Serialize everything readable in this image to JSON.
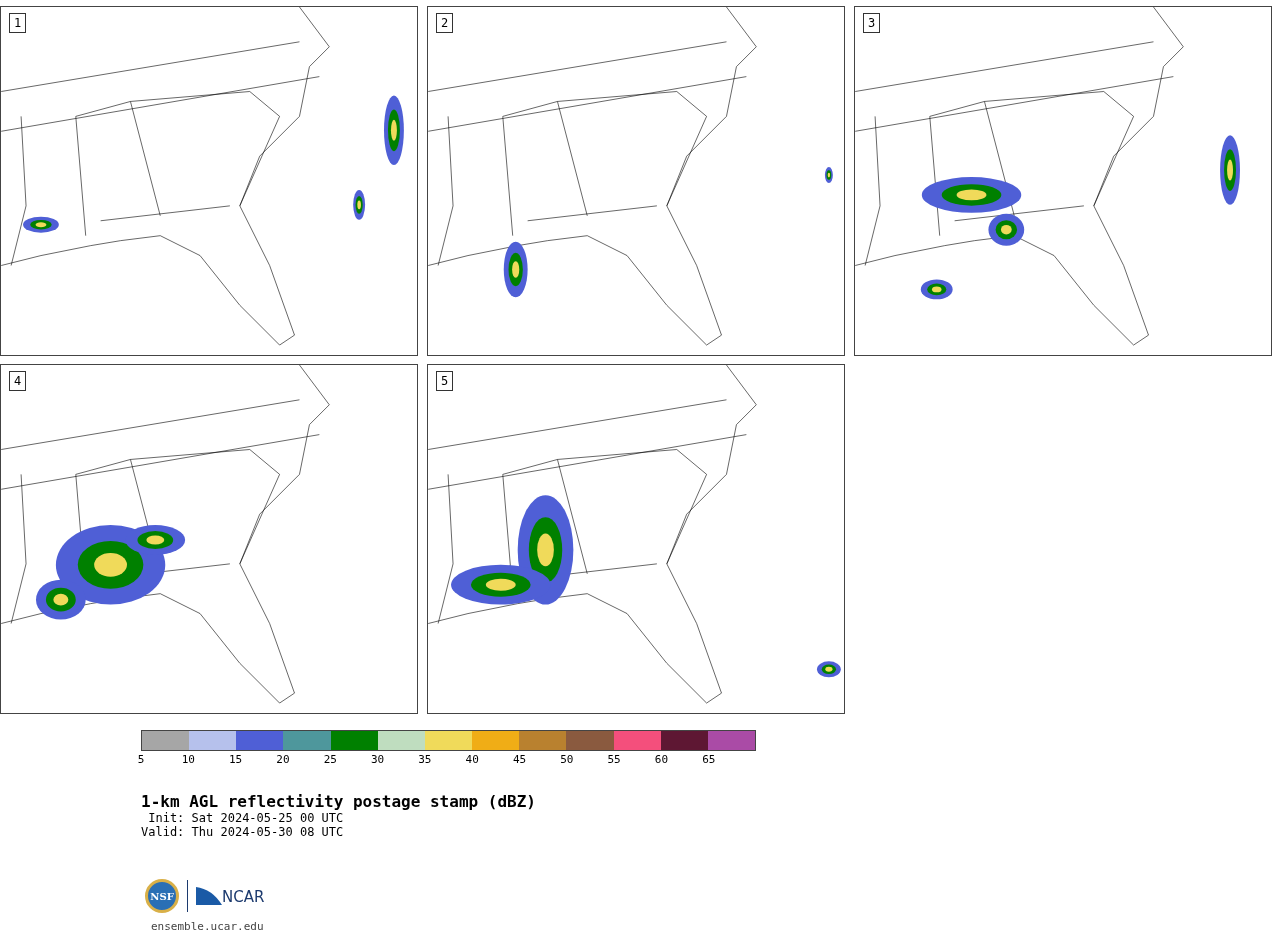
{
  "panels": [
    {
      "label": "1"
    },
    {
      "label": "2"
    },
    {
      "label": "3"
    },
    {
      "label": "4"
    },
    {
      "label": "5"
    }
  ],
  "colorbar": {
    "segments": [
      {
        "color": "#a6a6a6"
      },
      {
        "color": "#b6c1ec"
      },
      {
        "color": "#4f5fd6"
      },
      {
        "color": "#4e979c"
      },
      {
        "color": "#008000"
      },
      {
        "color": "#bfddbf"
      },
      {
        "color": "#f0da5a"
      },
      {
        "color": "#f0ad16"
      },
      {
        "color": "#b9812f"
      },
      {
        "color": "#8a5a3f"
      },
      {
        "color": "#f44f7c"
      },
      {
        "color": "#5e1733"
      },
      {
        "color": "#aa4ba6"
      }
    ],
    "ticks": [
      "5",
      "10",
      "15",
      "20",
      "25",
      "30",
      "35",
      "40",
      "45",
      "50",
      "55",
      "60",
      "65"
    ]
  },
  "title": "1-km AGL reflectivity postage stamp (dBZ)",
  "init": " Init: Sat 2024-05-25 00 UTC",
  "valid": "Valid: Thu 2024-05-30 08 UTC",
  "logo": {
    "nsf": "NSF",
    "ncar": "NCAR",
    "url": "ensemble.ucar.edu"
  }
}
